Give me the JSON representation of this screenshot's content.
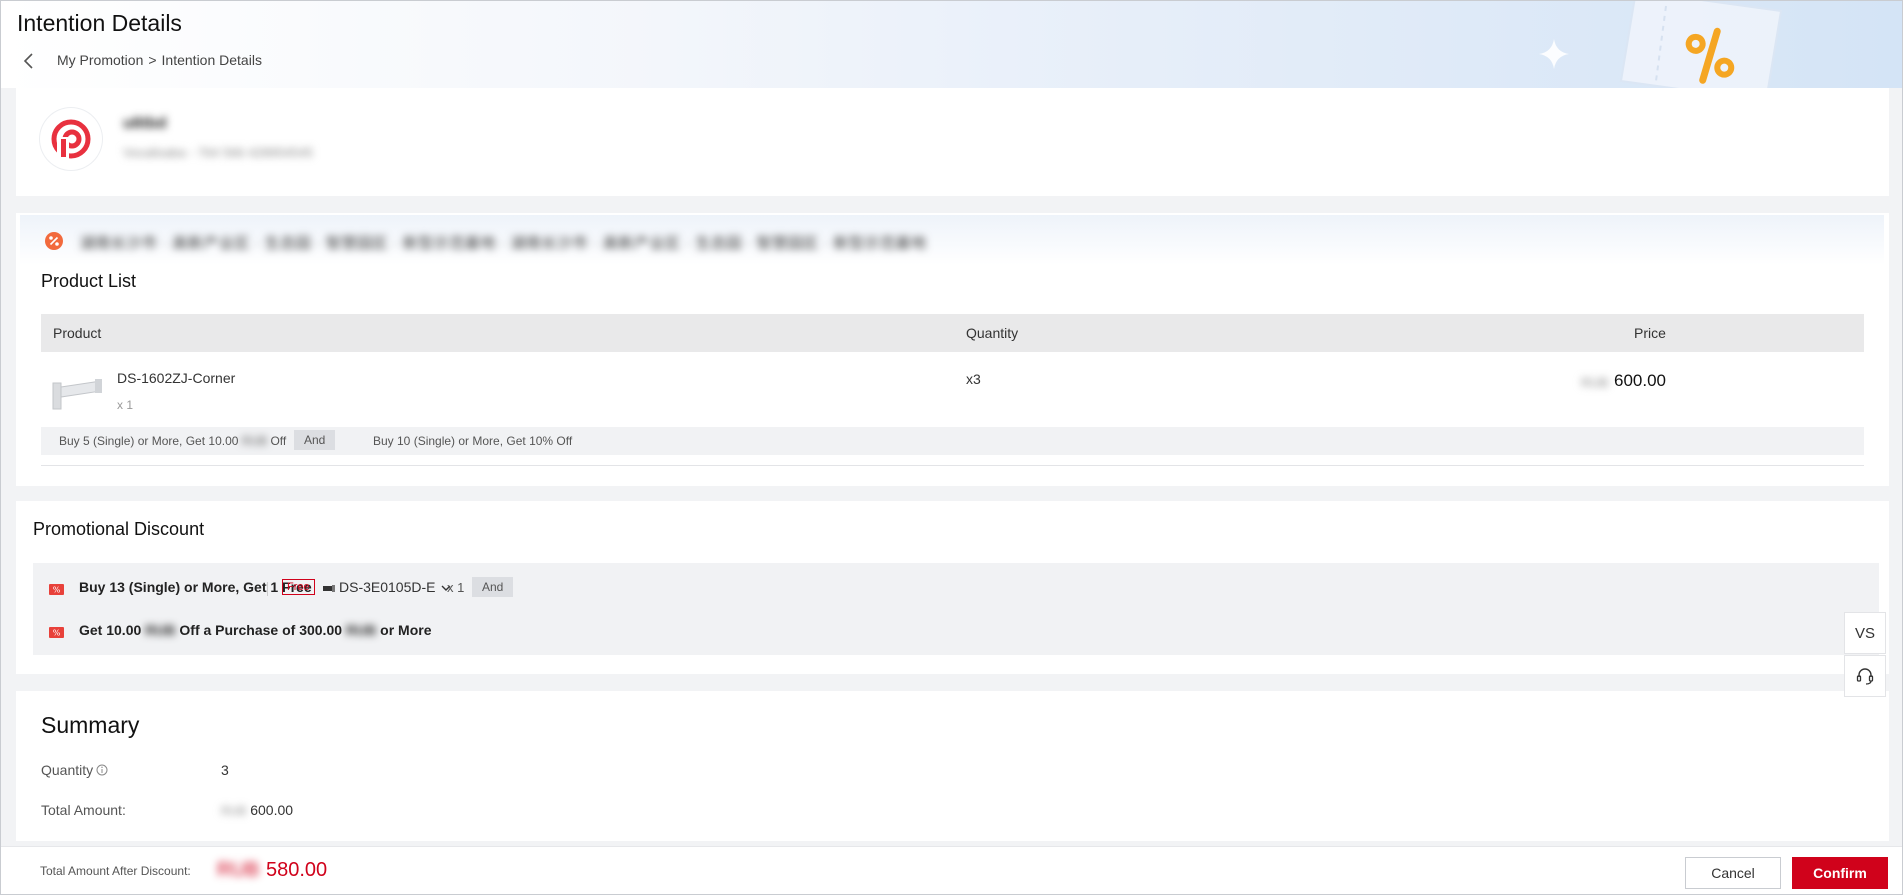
{
  "header": {
    "title": "Intention Details",
    "breadcrumb": {
      "parent": "My Promotion",
      "separator": ">",
      "current": "Intention Details"
    }
  },
  "merchant": {
    "name": "u6tbd",
    "subtitle": "Vocalisaba - 764 566 428954545"
  },
  "promotion_banner": {
    "text": "湖南长沙市 · 高新产业区 · 生态园 · 智慧园区 · 新型示范基地 · 湖南长沙市 · 高新产业区 · 生态园 · 智慧园区 · 新型示范基地"
  },
  "product_list": {
    "title": "Product List",
    "columns": {
      "product": "Product",
      "quantity": "Quantity",
      "price": "Price"
    },
    "rows": [
      {
        "name": "DS-1602ZJ-Corner",
        "sub": "x 1",
        "quantity": "x3",
        "currency": "RUB",
        "price": "600.00"
      }
    ],
    "rules": {
      "rule1_prefix": "Buy 5 (Single) or More, Get 10.00",
      "rule1_currency": "RUB",
      "rule1_suffix": "Off",
      "and": "And",
      "rule2": "Buy 10 (Single) or More, Get 10% Off"
    }
  },
  "promotional_discount": {
    "title": "Promotional Discount",
    "item1": {
      "text": "Buy 13 (Single) or More, Get 1 Free",
      "free_tag": "Free",
      "gift_model": "DS-3E0105D-E",
      "gift_qty": "x 1",
      "and": "And"
    },
    "item2": {
      "p1": "Get 10.00",
      "cur1": "RUB",
      "p2": "Off a Purchase of 300.00",
      "cur2": "RUB",
      "p3": "or More"
    }
  },
  "summary": {
    "title": "Summary",
    "quantity_label": "Quantity",
    "quantity_value": "3",
    "total_label": "Total Amount:",
    "total_currency": "RUB",
    "total_value": "600.00"
  },
  "footer": {
    "after_discount_label": "Total Amount After Discount:",
    "currency": "RUB",
    "after_discount_value": "580.00",
    "cancel_label": "Cancel",
    "confirm_label": "Confirm"
  },
  "float_buttons": {
    "vs_label": "VS"
  },
  "colors": {
    "accent": "#d0021b",
    "promo_orange": "#f26a3d",
    "header_gradient_end": "#d4e4f6"
  }
}
